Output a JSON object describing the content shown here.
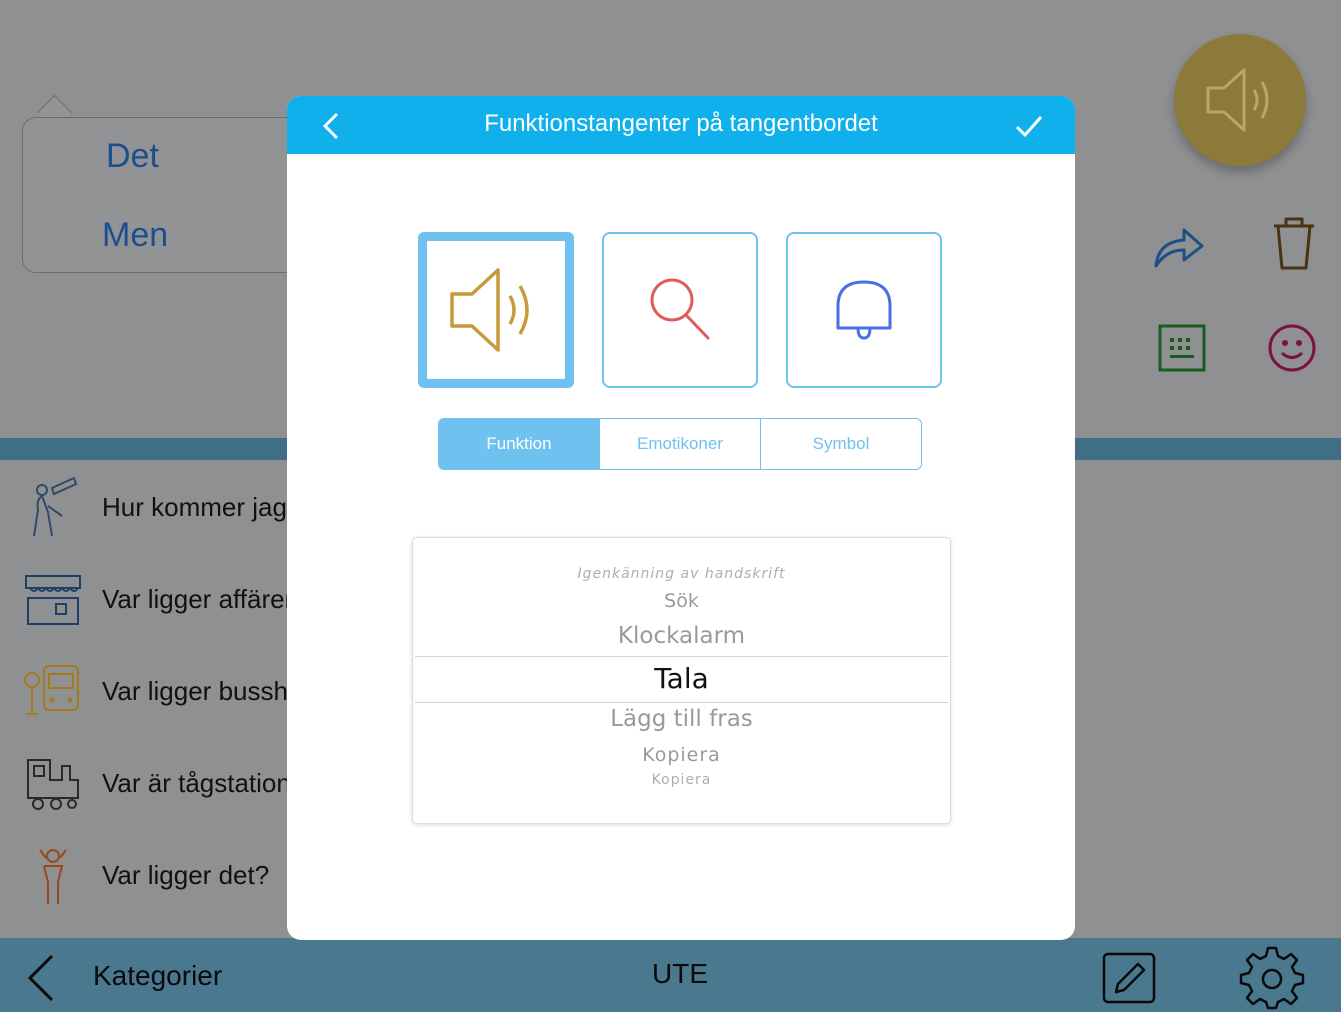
{
  "bubble": {
    "words": [
      "Det",
      "Men"
    ]
  },
  "list": {
    "items": [
      {
        "label": "Hur kommer jag",
        "icon": "telescope-icon"
      },
      {
        "label": "Var ligger affären",
        "icon": "shop-icon"
      },
      {
        "label": "Var ligger busshå",
        "icon": "bus-stop-icon"
      },
      {
        "label": "Var är tågstation",
        "icon": "train-icon"
      },
      {
        "label": "Var ligger det?",
        "icon": "person-question-icon"
      }
    ]
  },
  "bottom_bar": {
    "back_label": "Kategorier",
    "title": "UTE"
  },
  "modal": {
    "title": "Funktionstangenter på tangentbordet",
    "keys": [
      {
        "icon": "speaker-icon",
        "selected": true
      },
      {
        "icon": "search-icon",
        "selected": false
      },
      {
        "icon": "bell-icon",
        "selected": false
      }
    ],
    "tabs": [
      {
        "label": "Funktion",
        "active": true
      },
      {
        "label": "Emotikoner",
        "active": false
      },
      {
        "label": "Symbol",
        "active": false
      }
    ],
    "picker": {
      "options": [
        "Igenkänning av handskrift",
        "Sök",
        "Klockalarm",
        "Tala",
        "Lägg till fras",
        "Kopiera",
        "Kopiera"
      ],
      "selected": "Tala"
    }
  },
  "colors": {
    "header": "#0fb0ec",
    "accent": "#6fc1ef",
    "speaker_gold": "#c79a3a",
    "search_red": "#e05a5a",
    "bell_blue": "#4a6fe0"
  }
}
